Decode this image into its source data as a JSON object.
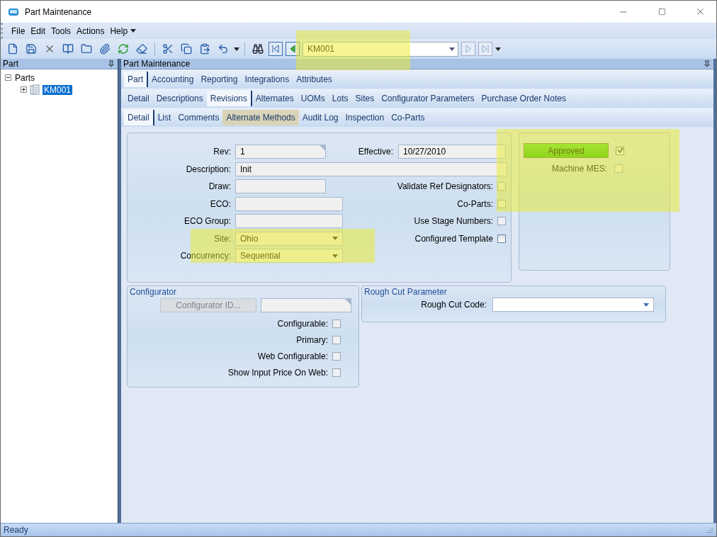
{
  "window": {
    "title": "Part Maintenance"
  },
  "menu": [
    "File",
    "Edit",
    "Tools",
    "Actions",
    "Help"
  ],
  "toolbar": {
    "record": "KM001"
  },
  "left_pane": {
    "title": "Part",
    "tree": [
      {
        "label": "Parts",
        "expanded": true,
        "selected": false,
        "children": [
          {
            "label": "KM001",
            "expanded": false,
            "selected": true
          }
        ]
      }
    ]
  },
  "right_pane": {
    "title": "Part Maintenance"
  },
  "tab_rows": [
    [
      {
        "label": "Part",
        "selected": true,
        "hovered": false
      },
      {
        "label": "Accounting",
        "selected": false,
        "hovered": false
      },
      {
        "label": "Reporting",
        "selected": false,
        "hovered": false
      },
      {
        "label": "Integrations",
        "selected": false,
        "hovered": false
      },
      {
        "label": "Attributes",
        "selected": false,
        "hovered": false
      }
    ],
    [
      {
        "label": "Detail",
        "selected": false,
        "hovered": false
      },
      {
        "label": "Descriptions",
        "selected": false,
        "hovered": false
      },
      {
        "label": "Revisions",
        "selected": true,
        "hovered": false
      },
      {
        "label": "Alternates",
        "selected": false,
        "hovered": false
      },
      {
        "label": "UOMs",
        "selected": false,
        "hovered": false
      },
      {
        "label": "Lots",
        "selected": false,
        "hovered": false
      },
      {
        "label": "Sites",
        "selected": false,
        "hovered": false
      },
      {
        "label": "Configurator Parameters",
        "selected": false,
        "hovered": false
      },
      {
        "label": "Purchase Order Notes",
        "selected": false,
        "hovered": false
      }
    ],
    [
      {
        "label": "Detail",
        "selected": true,
        "hovered": false
      },
      {
        "label": "List",
        "selected": false,
        "hovered": false
      },
      {
        "label": "Comments",
        "selected": false,
        "hovered": false
      },
      {
        "label": "Alternate Methods",
        "selected": false,
        "hovered": true
      },
      {
        "label": "Audit Log",
        "selected": false,
        "hovered": false
      },
      {
        "label": "Inspection",
        "selected": false,
        "hovered": false
      },
      {
        "label": "Co-Parts",
        "selected": false,
        "hovered": false
      }
    ]
  ],
  "form": {
    "rev": {
      "label": "Rev:",
      "value": "1"
    },
    "effective": {
      "label": "Effective:",
      "value": "10/27/2010"
    },
    "description": {
      "label": "Description:",
      "value": "Init"
    },
    "left_fields": [
      {
        "label": "Draw:",
        "kind": "short"
      },
      {
        "label": "ECO:",
        "kind": "text"
      },
      {
        "label": "ECO Group:",
        "kind": "text"
      },
      {
        "label": "Site:",
        "kind": "combo",
        "value": "Ohio"
      },
      {
        "label": "Concurrency:",
        "kind": "combo",
        "value": "Sequential"
      }
    ],
    "checkboxes": [
      {
        "label": "Validate Ref Designators:",
        "checked": false,
        "disabled": true
      },
      {
        "label": "Co-Parts:",
        "checked": false,
        "disabled": true
      },
      {
        "label": "Use Stage Numbers:",
        "checked": false,
        "disabled": true
      },
      {
        "label": "Configured Template",
        "checked": false,
        "disabled": false
      }
    ]
  },
  "status_panel": {
    "button": "Approved",
    "approved": true,
    "checkbox": {
      "label": "Machine MES:",
      "checked": false,
      "disabled": true
    }
  },
  "configurator": {
    "title": "Configurator",
    "button": {
      "label": "Configurator ID...",
      "disabled": true
    },
    "checkboxes": [
      {
        "label": "Configurable:",
        "checked": false,
        "disabled": true
      },
      {
        "label": "Primary:",
        "checked": false,
        "disabled": true
      },
      {
        "label": "Web Configurable:",
        "checked": false,
        "disabled": true
      },
      {
        "label": "Show Input Price On Web:",
        "checked": false,
        "disabled": true
      }
    ]
  },
  "rough_cut": {
    "title": "Rough Cut Parameter",
    "label": "Rough Cut Code:"
  },
  "status_bar": "Ready"
}
